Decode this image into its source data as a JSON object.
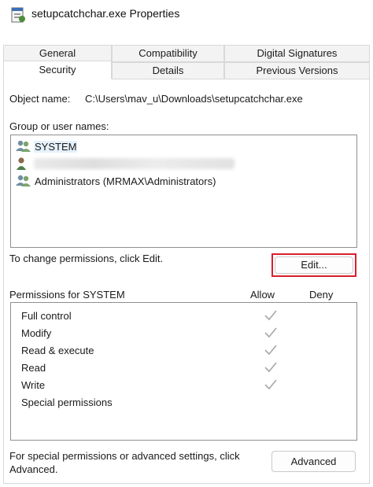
{
  "window": {
    "title": "setupcatchchar.exe Properties"
  },
  "tabs": {
    "row1": [
      "General",
      "Compatibility",
      "Digital Signatures"
    ],
    "row2": [
      "Security",
      "Details",
      "Previous Versions"
    ],
    "active": "Security"
  },
  "security": {
    "object_name_label": "Object name:",
    "object_name_value": "C:\\Users\\mav_u\\Downloads\\setupcatchchar.exe",
    "group_label": "Group or user names:",
    "users": [
      {
        "name": "SYSTEM",
        "icon": "user-group-icon"
      },
      {
        "name": "",
        "icon": "user-icon",
        "redacted": true
      },
      {
        "name": "Administrators (MRMAX\\Administrators)",
        "icon": "user-group-icon"
      }
    ],
    "change_text": "To change permissions, click Edit.",
    "edit_button": "Edit...",
    "permissions_header": "Permissions for SYSTEM",
    "allow_label": "Allow",
    "deny_label": "Deny",
    "permissions": [
      {
        "name": "Full control",
        "allow": true,
        "deny": false
      },
      {
        "name": "Modify",
        "allow": true,
        "deny": false
      },
      {
        "name": "Read & execute",
        "allow": true,
        "deny": false
      },
      {
        "name": "Read",
        "allow": true,
        "deny": false
      },
      {
        "name": "Write",
        "allow": true,
        "deny": false
      },
      {
        "name": "Special permissions",
        "allow": false,
        "deny": false
      }
    ],
    "advanced_text_line1": "For special permissions or advanced settings, click",
    "advanced_text_line2": "Advanced.",
    "advanced_button": "Advanced"
  },
  "colors": {
    "highlight": "#d6202e",
    "check_gray": "#a8a8a8",
    "selection": "#e5f1fb"
  }
}
